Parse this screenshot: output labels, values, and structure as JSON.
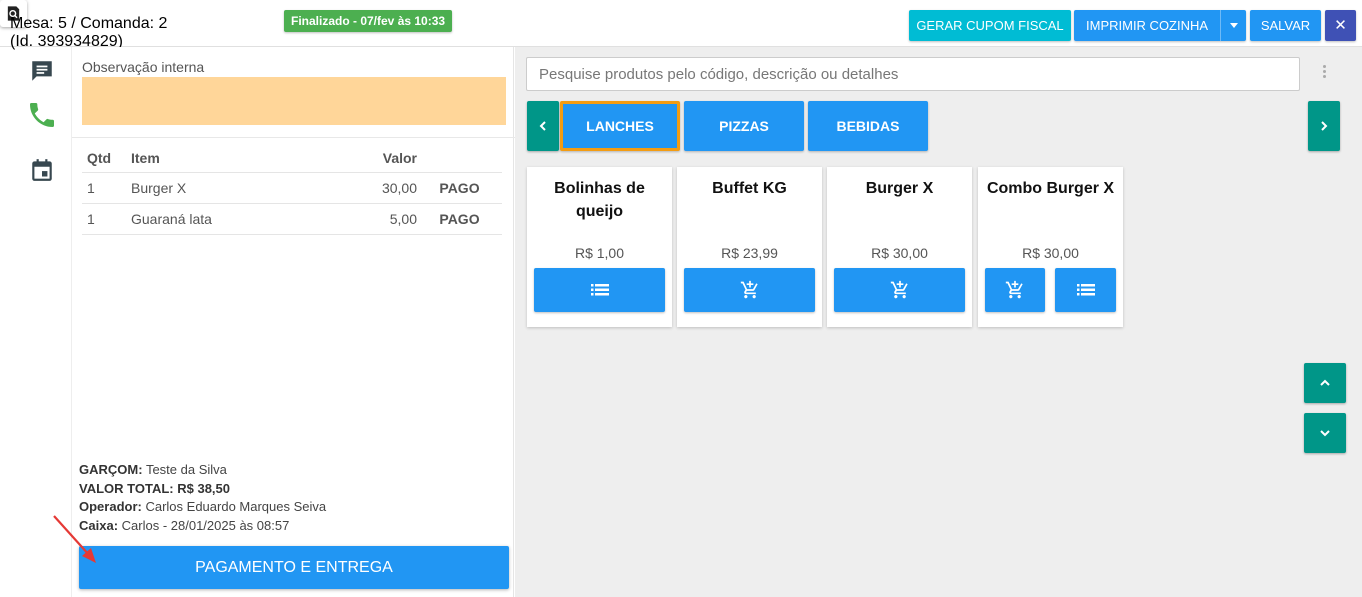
{
  "header": {
    "mesa_line1": "Mesa: 5 / Comanda: 2",
    "mesa_line2": "(Id. 393934829)",
    "status": "Finalizado - 07/fev às 10:33",
    "btn_cupom": "GERAR CUPOM FISCAL",
    "btn_cozinha": "IMPRIMIR COZINHA",
    "btn_salvar": "SALVAR",
    "btn_close": "✕"
  },
  "left": {
    "obs_label": "Observação interna",
    "table": {
      "headers": [
        "Qtd",
        "Item",
        "Valor"
      ],
      "rows": [
        {
          "qtd": "1",
          "item": "Burger X",
          "valor": "30,00",
          "status": "PAGO"
        },
        {
          "qtd": "1",
          "item": "Guaraná lata",
          "valor": "5,00",
          "status": "PAGO"
        }
      ]
    },
    "info": {
      "garcom_label": "GARÇOM:",
      "garcom": "Teste da Silva",
      "total_label": "VALOR TOTAL:",
      "total": "R$ 38,50",
      "operador_label": "Operador:",
      "operador": "Carlos Eduardo Marques Seiva",
      "caixa_label": "Caixa:",
      "caixa": "Carlos - 28/01/2025 às 08:57"
    },
    "btn_pagamento": "PAGAMENTO E ENTREGA"
  },
  "right": {
    "search_placeholder": "Pesquise produtos pelo código, descrição ou detalhes",
    "categories": [
      "LANCHES",
      "PIZZAS",
      "BEBIDAS"
    ],
    "products": [
      {
        "name": "Bolinhas de queijo",
        "price": "R$ 1,00"
      },
      {
        "name": "Buffet KG",
        "price": "R$ 23,99"
      },
      {
        "name": "Burger X",
        "price": "R$ 30,00"
      },
      {
        "name": "Combo Burger X",
        "price": "R$ 30,00"
      }
    ]
  },
  "colors": {
    "primary": "#2196f3",
    "teal": "#009688",
    "cyan": "#00bcd4",
    "indigo": "#3f51b5",
    "success": "#4caf50",
    "obs_bg": "#ffd699",
    "active_border": "#f39c12"
  }
}
